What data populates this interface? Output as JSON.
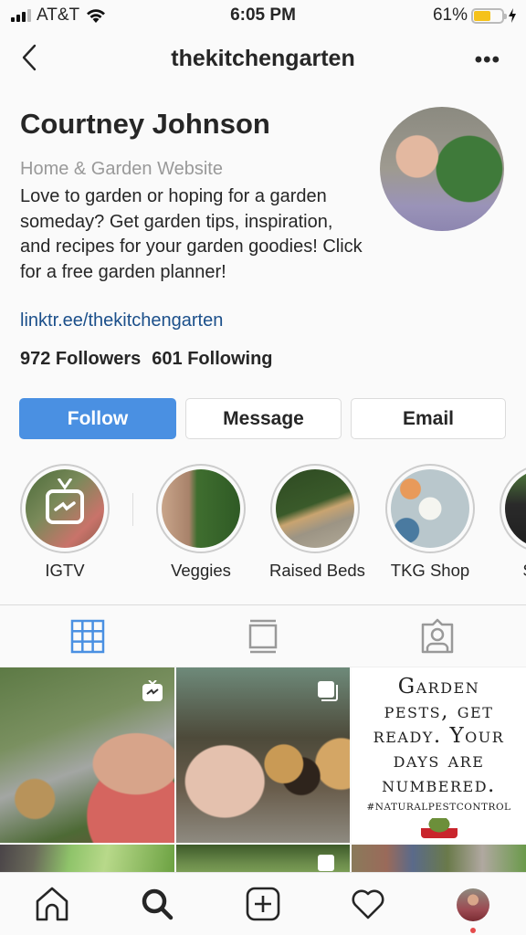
{
  "status_bar": {
    "carrier": "AT&T",
    "time": "6:05 PM",
    "battery_percent_label": "61%",
    "battery_level": 0.61,
    "charging": true
  },
  "header": {
    "username": "thekitchengarten",
    "back_icon": "chevron-left-icon",
    "more_icon": "more-horizontal-icon",
    "more_label": "•••"
  },
  "profile": {
    "name": "Courtney Johnson",
    "category": "Home & Garden Website",
    "bio": "Love to garden or hoping for a garden someday? Get garden tips, inspiration, and recipes for your garden goodies! Click for a free garden planner!",
    "link": "linktr.ee/thekitchengarten",
    "followers_label": "972 Followers",
    "following_label": "601 Following"
  },
  "actions": {
    "follow": "Follow",
    "message": "Message",
    "email": "Email",
    "accent": "#4a90e2"
  },
  "highlights": [
    {
      "label": "IGTV"
    },
    {
      "label": "Veggies"
    },
    {
      "label": "Raised Beds"
    },
    {
      "label": "TKG Shop"
    },
    {
      "label": "Salad"
    }
  ],
  "tabs": [
    {
      "name": "grid",
      "icon": "grid-icon",
      "active": true
    },
    {
      "name": "feed",
      "icon": "feed-icon",
      "active": false
    },
    {
      "name": "tagged",
      "icon": "tagged-icon",
      "active": false
    }
  ],
  "posts": [
    {
      "type": "igtv",
      "badge": "igtv-icon"
    },
    {
      "type": "multi",
      "badge": "carousel-icon"
    },
    {
      "type": "quote",
      "lines": [
        "Garden",
        "pests, get",
        "ready. Your",
        "days are",
        "numbered."
      ],
      "tag": "#NATURALPESTCONTROL"
    },
    {
      "type": "photo"
    },
    {
      "type": "multi",
      "badge": "carousel-icon"
    },
    {
      "type": "photo"
    }
  ],
  "bottom_nav": [
    {
      "name": "home",
      "icon": "home-icon"
    },
    {
      "name": "search",
      "icon": "search-icon"
    },
    {
      "name": "new-post",
      "icon": "plus-square-icon"
    },
    {
      "name": "activity",
      "icon": "heart-icon"
    },
    {
      "name": "profile",
      "icon": "profile-avatar"
    }
  ]
}
